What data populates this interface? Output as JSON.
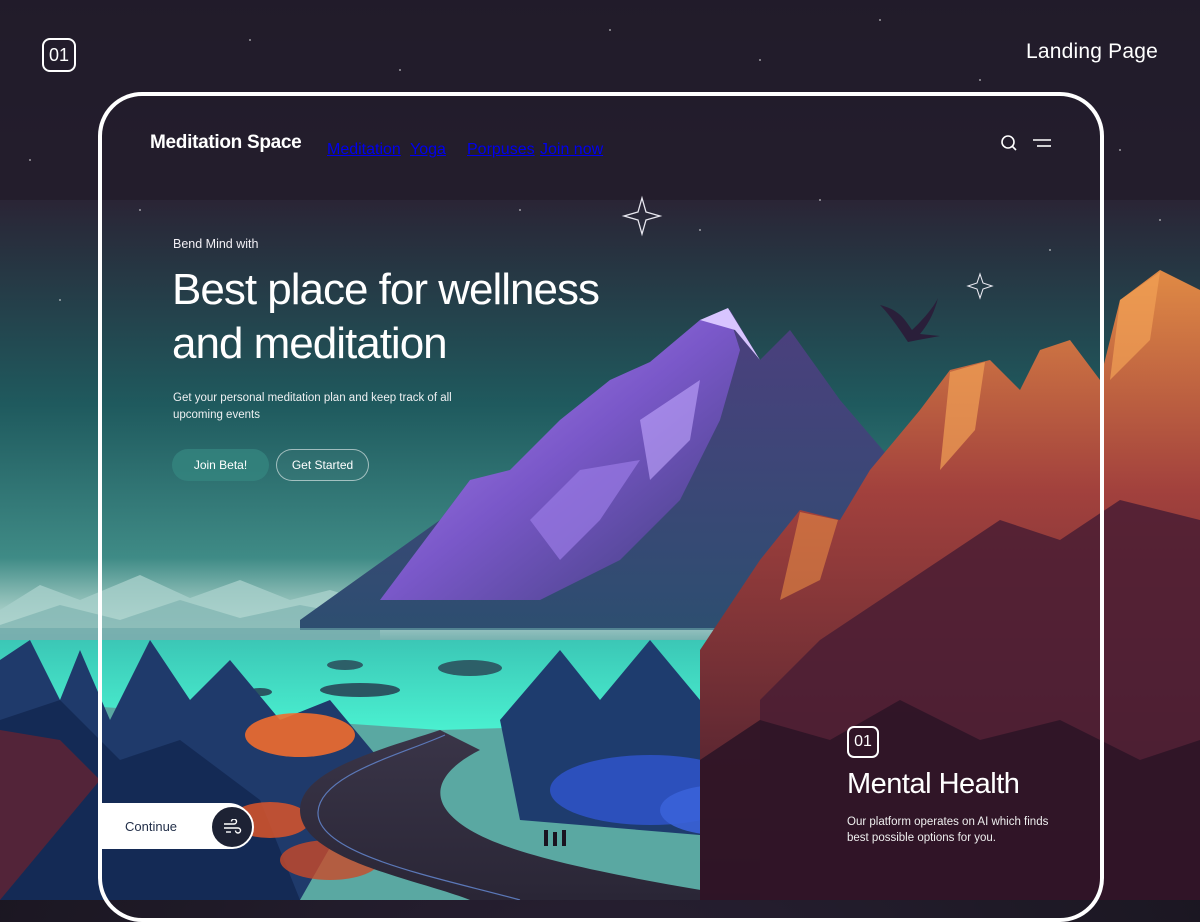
{
  "page_badge": "01",
  "page_label": "Landing Page",
  "header": {
    "logo": "Meditation Space",
    "nav": [
      "Meditation",
      "Yoga",
      "Porpuses",
      "Join now"
    ],
    "icons": [
      "search-icon",
      "menu-icon"
    ]
  },
  "hero": {
    "eyebrow": "Bend Mind with",
    "title_line1": "Best place for wellness",
    "title_line2": "and meditation",
    "subtitle": "Get your personal meditation plan and keep track of all upcoming events",
    "primary_button": "Join Beta!",
    "secondary_button": "Get Started"
  },
  "continue": {
    "label": "Continue",
    "icon": "wind-icon"
  },
  "card": {
    "badge": "01",
    "title": "Mental Health",
    "text": "Our platform operates on AI which finds best possible options for you."
  },
  "colors": {
    "sky_top": "#2a2235",
    "sky_mid": "#2f6f73",
    "lake": "#45e3c7",
    "mountain_purple": "#8a64d8",
    "cliff_orange": "#d9763c",
    "cliff_dark": "#5a2336",
    "button_teal": "#34847e"
  }
}
